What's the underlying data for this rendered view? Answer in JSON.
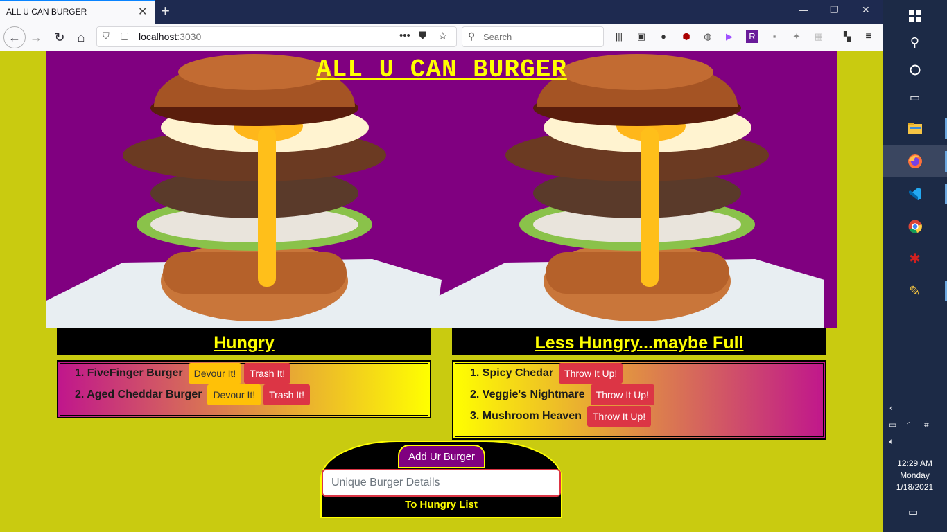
{
  "browser": {
    "tab_title": "ALL U CAN BURGER",
    "url_host": "localhost",
    "url_port": ":3030",
    "search_placeholder": "Search"
  },
  "page": {
    "title": "ALL U CAN BURGER",
    "hungry_header": "Hungry",
    "full_header": "Less Hungry...maybe Full",
    "hungry_items": [
      {
        "label": "1. FiveFinger Burger",
        "devour": "Devour It!",
        "trash": "Trash It!"
      },
      {
        "label": "2. Aged Cheddar Burger",
        "devour": "Devour It!",
        "trash": "Trash It!"
      }
    ],
    "full_items": [
      {
        "label": "1. Spicy Chedar",
        "throw": "Throw It Up!"
      },
      {
        "label": "2. Veggie's Nightmare",
        "throw": "Throw It Up!"
      },
      {
        "label": "3. Mushroom Heaven",
        "throw": "Throw It Up!"
      }
    ],
    "form": {
      "label": "Add Ur Burger",
      "placeholder": "Unique Burger Details",
      "submit": "To Hungry List"
    }
  },
  "colors": {
    "page_bg": "#c9cb10",
    "hero_bg": "#800080",
    "accent_yellow": "#ffff00",
    "magenta": "#c0168c",
    "button_yellow": "#ffc107",
    "button_red": "#dc3545"
  },
  "taskbar": {
    "time": "12:29 AM",
    "day": "Monday",
    "date": "1/18/2021"
  }
}
